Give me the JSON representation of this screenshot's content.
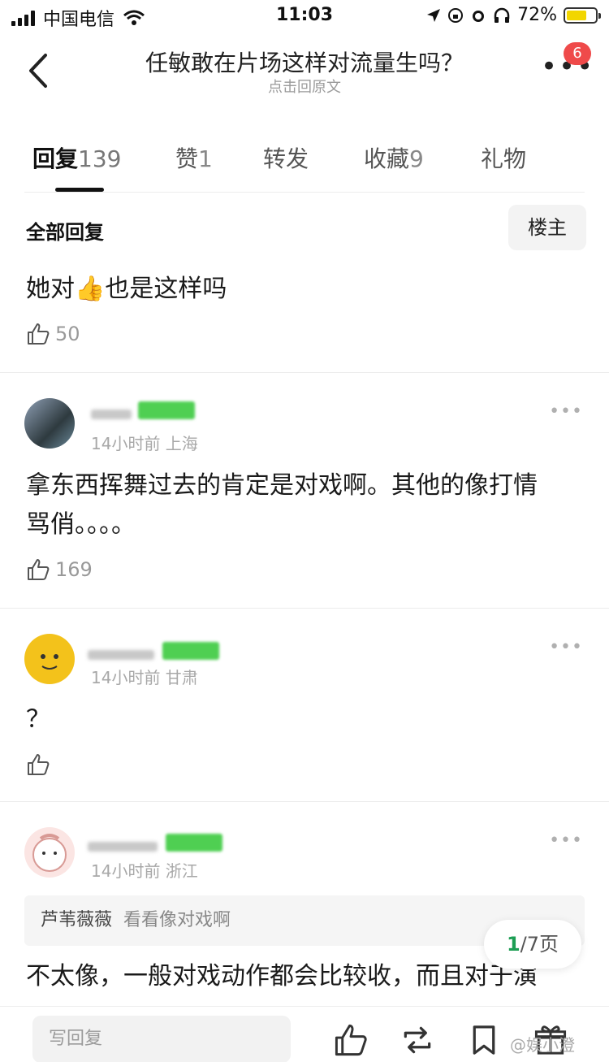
{
  "status_bar": {
    "carrier": "中国电信",
    "time": "11:03",
    "battery": "72%",
    "battery_level": 0.72
  },
  "nav": {
    "title": "任敏敢在片场这样对流量生吗？",
    "subtitle": "点击回原文",
    "badge_count": "6"
  },
  "tabs": [
    {
      "label": "回复",
      "count": "139"
    },
    {
      "label": "赞",
      "count": "1"
    },
    {
      "label": "转发",
      "count": ""
    },
    {
      "label": "收藏",
      "count": "9"
    },
    {
      "label": "礼物",
      "count": ""
    }
  ],
  "section": {
    "title": "全部回复",
    "filter_button": "楼主"
  },
  "main_post": {
    "text_before": "她对",
    "emoji": "👍",
    "text_after": "也是这样吗",
    "likes": "50"
  },
  "comments": [
    {
      "meta": "14小时前  上海",
      "text_line1": "拿东西挥舞过去的肯定是对戏啊。其他的像打情",
      "text_line2": "骂俏。。。。",
      "likes": "169"
    },
    {
      "meta": "14小时前  甘肃",
      "text": "？",
      "likes": ""
    },
    {
      "meta": "14小时前  浙江",
      "quote_name": "芦苇薇薇",
      "quote_text": "看看像对戏啊",
      "text": "不太像，一般对戏动作都会比较收，而且对于演"
    }
  ],
  "pager": {
    "current": "1",
    "total": "/7页"
  },
  "bottom_bar": {
    "reply_placeholder": "写回复"
  },
  "watermark": "@娱小澄",
  "colors": {
    "accent_green": "#1d9e54",
    "badge_red": "#ef4a4a"
  }
}
